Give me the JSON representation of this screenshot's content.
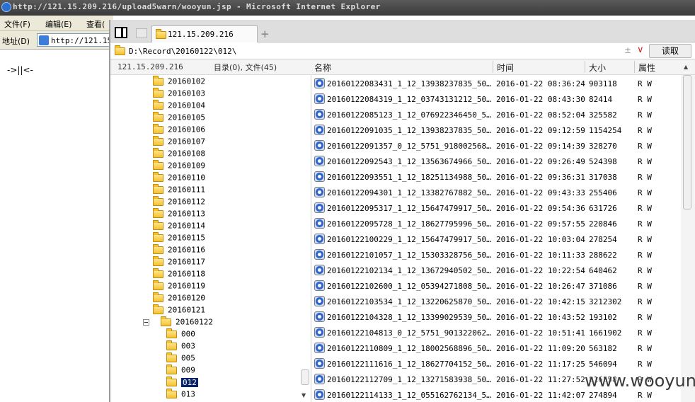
{
  "ie": {
    "title": "http://121.15.209.216/upload5warn/wooyun.jsp - Microsoft Internet Explorer",
    "menu": [
      "文件(F)",
      "编辑(E)",
      "查看("
    ],
    "address_label": "地址(D)",
    "address_value": "http://121.15",
    "page_text": "->||<-"
  },
  "fm": {
    "tab_label": "121.15.209.216",
    "new_tab": "+",
    "path": "D:\\Record\\20160122\\012\\",
    "path_extra": "±",
    "path_dropdown": "∨",
    "read_button": "读取",
    "host": "121.15.209.216",
    "counts": "目录(0), 文件(45)",
    "columns": {
      "name": "名称",
      "time": "时间",
      "size": "大小",
      "attr": "属性"
    },
    "tree": [
      {
        "label": "20160102"
      },
      {
        "label": "20160103"
      },
      {
        "label": "20160104"
      },
      {
        "label": "20160105"
      },
      {
        "label": "20160106"
      },
      {
        "label": "20160107"
      },
      {
        "label": "20160108"
      },
      {
        "label": "20160109"
      },
      {
        "label": "20160110"
      },
      {
        "label": "20160111"
      },
      {
        "label": "20160112"
      },
      {
        "label": "20160113"
      },
      {
        "label": "20160114"
      },
      {
        "label": "20160115"
      },
      {
        "label": "20160116"
      },
      {
        "label": "20160117"
      },
      {
        "label": "20160118"
      },
      {
        "label": "20160119"
      },
      {
        "label": "20160120"
      },
      {
        "label": "20160121"
      },
      {
        "label": "20160122",
        "expanded": true
      }
    ],
    "subtree": [
      {
        "label": "000"
      },
      {
        "label": "003"
      },
      {
        "label": "005"
      },
      {
        "label": "009"
      },
      {
        "label": "012",
        "selected": true
      },
      {
        "label": "013"
      }
    ],
    "files": [
      {
        "name": "20160122083431_1_12_13938237835_5000...",
        "time": "2016-01-22 08:36:24",
        "size": "903118",
        "attr": "R W"
      },
      {
        "name": "20160122084319_1_12_03743131212_5000...",
        "time": "2016-01-22 08:43:30",
        "size": "82414",
        "attr": "R W"
      },
      {
        "name": "20160122085123_1_12_076922346450_500...",
        "time": "2016-01-22 08:52:04",
        "size": "325582",
        "attr": "R W"
      },
      {
        "name": "20160122091035_1_12_13938237835_5000...",
        "time": "2016-01-22 09:12:59",
        "size": "1154254",
        "attr": "R W"
      },
      {
        "name": "20160122091357_0_12_5751_91800256872...",
        "time": "2016-01-22 09:14:39",
        "size": "328270",
        "attr": "R W"
      },
      {
        "name": "20160122092543_1_12_13563674966_5000...",
        "time": "2016-01-22 09:26:49",
        "size": "524398",
        "attr": "R W"
      },
      {
        "name": "20160122093551_1_12_18251134988_5000...",
        "time": "2016-01-22 09:36:31",
        "size": "317038",
        "attr": "R W"
      },
      {
        "name": "20160122094301_1_12_13382767882_5000...",
        "time": "2016-01-22 09:43:33",
        "size": "255406",
        "attr": "R W"
      },
      {
        "name": "20160122095317_1_12_15647479917_5000...",
        "time": "2016-01-22 09:54:36",
        "size": "631726",
        "attr": "R W"
      },
      {
        "name": "20160122095728_1_12_18627795996_5000...",
        "time": "2016-01-22 09:57:55",
        "size": "220846",
        "attr": "R W"
      },
      {
        "name": "20160122100229_1_12_15647479917_5000...",
        "time": "2016-01-22 10:03:04",
        "size": "278254",
        "attr": "R W"
      },
      {
        "name": "20160122101057_1_12_15303328756_5000...",
        "time": "2016-01-22 10:11:33",
        "size": "288622",
        "attr": "R W"
      },
      {
        "name": "20160122102134_1_12_13672940502_5000...",
        "time": "2016-01-22 10:22:54",
        "size": "640462",
        "attr": "R W"
      },
      {
        "name": "20160122102600_1_12_05394271808_5000...",
        "time": "2016-01-22 10:26:47",
        "size": "371086",
        "attr": "R W"
      },
      {
        "name": "20160122103534_1_12_13220625870_5000...",
        "time": "2016-01-22 10:42:15",
        "size": "3212302",
        "attr": "R W"
      },
      {
        "name": "20160122104328_1_12_13399029539_5000...",
        "time": "2016-01-22 10:43:52",
        "size": "193102",
        "attr": "R W"
      },
      {
        "name": "20160122104813_0_12_5751_90132206258...",
        "time": "2016-01-22 10:51:41",
        "size": "1661902",
        "attr": "R W"
      },
      {
        "name": "20160122110809_1_12_18002568896_5000...",
        "time": "2016-01-22 11:09:20",
        "size": "563182",
        "attr": "R W"
      },
      {
        "name": "20160122111616_1_12_18627704152_5000...",
        "time": "2016-01-22 11:17:25",
        "size": "546094",
        "attr": "R W"
      },
      {
        "name": "20160122112709_1_12_13271583938_5000...",
        "time": "2016-01-22 11:27:52",
        "size": "816558",
        "attr": "R W"
      },
      {
        "name": "20160122114133_1_12_055162762134_500...",
        "time": "2016-01-22 11:42:07",
        "size": "274894",
        "attr": "R W"
      }
    ]
  },
  "watermark": "www.wooyun.org"
}
